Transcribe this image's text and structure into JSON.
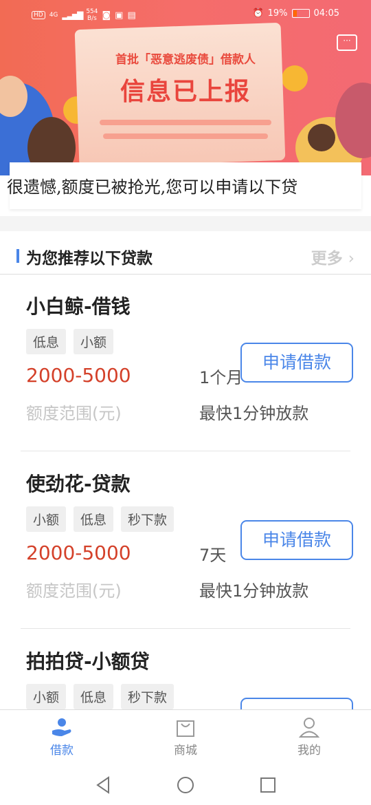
{
  "status_bar": {
    "hd": "HD",
    "net": "4G",
    "speed_top": "554",
    "speed_unit": "B/s",
    "battery": "19%",
    "time": "04:05"
  },
  "banner": {
    "line1": "首批「恶意逃废债」借款人",
    "line2": "信息已上报"
  },
  "notice": "很遗憾,额度已被抢光,您可以申请以下贷",
  "section": {
    "title": "为您推荐以下贷款",
    "more": "更多"
  },
  "loans": [
    {
      "name": "小白鲸-借钱",
      "tags": [
        "低息",
        "小额"
      ],
      "range": "2000-5000",
      "range_label": "额度范围(元)",
      "term": "1个月",
      "speed": "最快1分钟放款",
      "apply": "申请借款"
    },
    {
      "name": "使劲花-贷款",
      "tags": [
        "小额",
        "低息",
        "秒下款"
      ],
      "range": "2000-5000",
      "range_label": "额度范围(元)",
      "term": "7天",
      "speed": "最快1分钟放款",
      "apply": "申请借款"
    },
    {
      "name": "拍拍贷-小额贷",
      "tags": [
        "小额",
        "低息",
        "秒下款"
      ],
      "range": "",
      "range_label": "",
      "term": "",
      "speed": "",
      "apply": ""
    }
  ],
  "tabs": [
    {
      "label": "借款",
      "icon": "loan-hand-icon",
      "active": true
    },
    {
      "label": "商城",
      "icon": "shopping-bag-icon",
      "active": false
    },
    {
      "label": "我的",
      "icon": "user-icon",
      "active": false
    }
  ],
  "colors": {
    "accent": "#4a86e8",
    "amount": "#d4412a",
    "banner": "#f26b54"
  }
}
